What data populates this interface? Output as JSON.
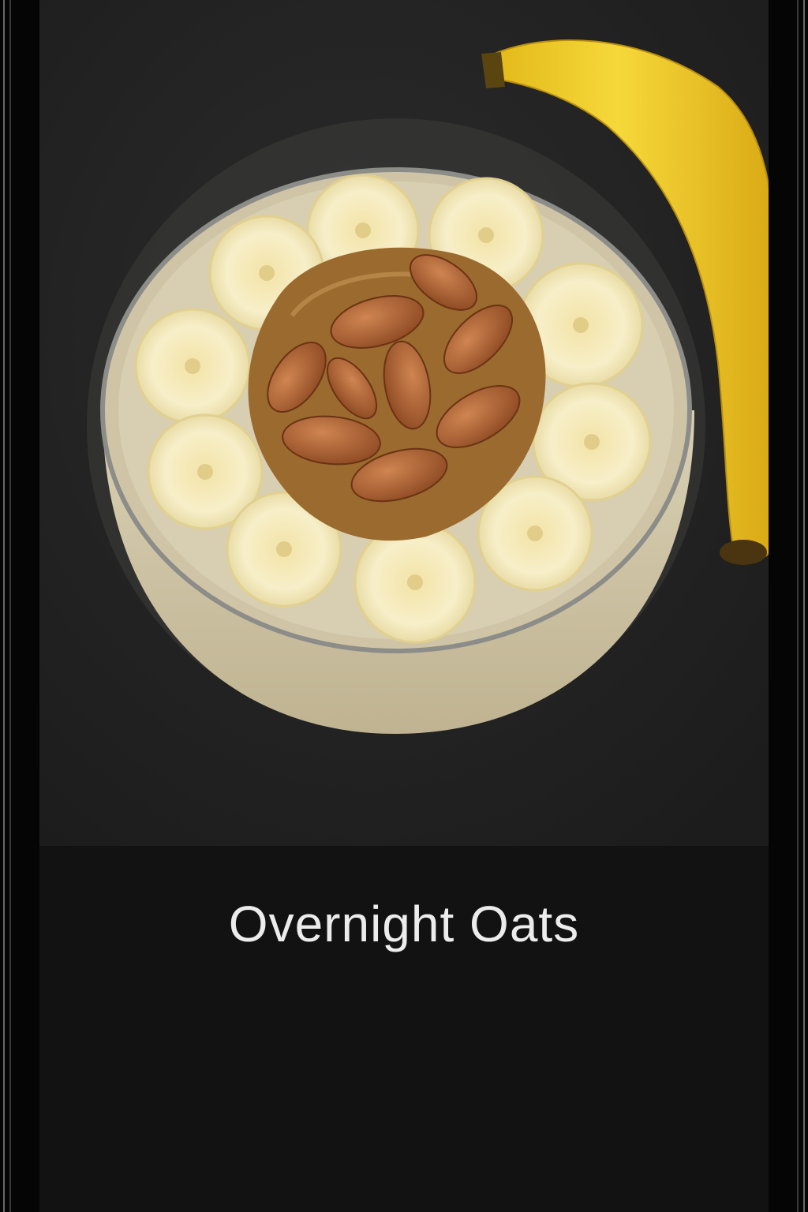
{
  "card": {
    "title": "Overnight Oats",
    "image": {
      "subject_icon": "overnight-oats-photo-icon"
    }
  },
  "colors": {
    "background": "#131313",
    "photo_backdrop": "#232323",
    "title_text": "#ececec",
    "banana": "#f1cf2a",
    "almond": "#b5653a",
    "nut_butter": "#9a6a2e",
    "oats": "#d8cfb2"
  }
}
